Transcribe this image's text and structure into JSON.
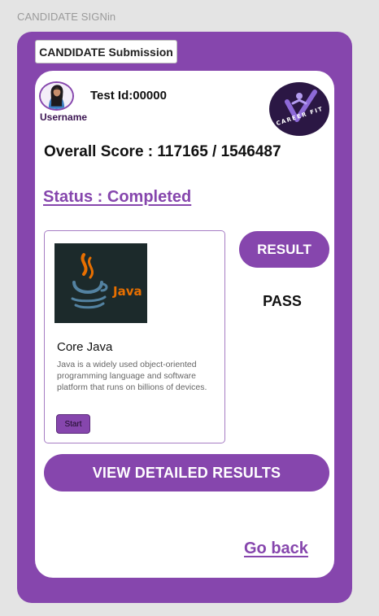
{
  "page": {
    "label": "CANDIDATE SIGNin"
  },
  "header": {
    "tab_label": "CANDIDATE Submission"
  },
  "profile": {
    "username": "Username",
    "test_id": "Test Id:00000",
    "avatar_icon": "user-avatar-icon"
  },
  "brand": {
    "name": "CAREER FIT",
    "logo_icon": "career-fit-logo"
  },
  "score": {
    "text": "Overall Score : 117165 / 1546487"
  },
  "status": {
    "text": "Status : Completed"
  },
  "course": {
    "title": "Core Java",
    "description": "Java is a widely used object-oriented programming language and software platform that runs on billions of devices.",
    "thumb_label": "Java",
    "thumb_icon": "java-cup-icon",
    "start_label": "Start"
  },
  "result": {
    "button_label": "RESULT",
    "value": "PASS"
  },
  "actions": {
    "detailed_label": "VIEW DETAILED RESULTS",
    "go_back_label": "Go back"
  },
  "colors": {
    "accent": "#8646ad",
    "background": "#e4e4e4",
    "card": "#ffffff",
    "logo_bg": "#2b1744",
    "java_orange": "#e76f00",
    "java_blue": "#5382a1"
  }
}
